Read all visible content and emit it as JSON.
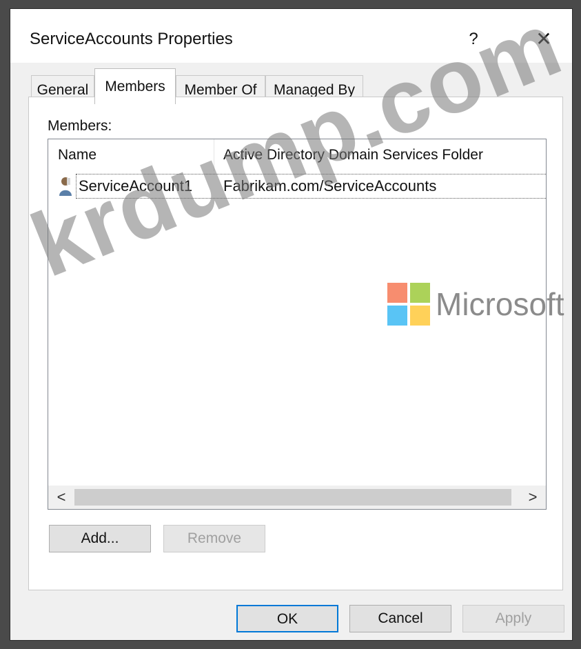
{
  "dialog": {
    "title": "ServiceAccounts Properties",
    "help_label": "?",
    "close_label": "✕"
  },
  "tabs": [
    {
      "label": "General"
    },
    {
      "label": "Members",
      "active": true
    },
    {
      "label": "Member Of"
    },
    {
      "label": "Managed By"
    }
  ],
  "members": {
    "label": "Members:",
    "columns": [
      "Name",
      "Active Directory Domain Services Folder"
    ],
    "rows": [
      {
        "name": "ServiceAccount1",
        "folder": "Fabrikam.com/ServiceAccounts",
        "icon": "user-icon"
      }
    ],
    "scroll_left": "<",
    "scroll_right": ">"
  },
  "buttons": {
    "add": "Add...",
    "remove": "Remove",
    "ok": "OK",
    "cancel": "Cancel",
    "apply": "Apply"
  },
  "watermark": {
    "text": "krdump.com",
    "brand": "Microsoft"
  },
  "colors": {
    "ms_red": "#f25022",
    "ms_green": "#7fba00",
    "ms_blue": "#00a4ef",
    "ms_yellow": "#ffb900",
    "default_button_border": "#0078d7"
  }
}
